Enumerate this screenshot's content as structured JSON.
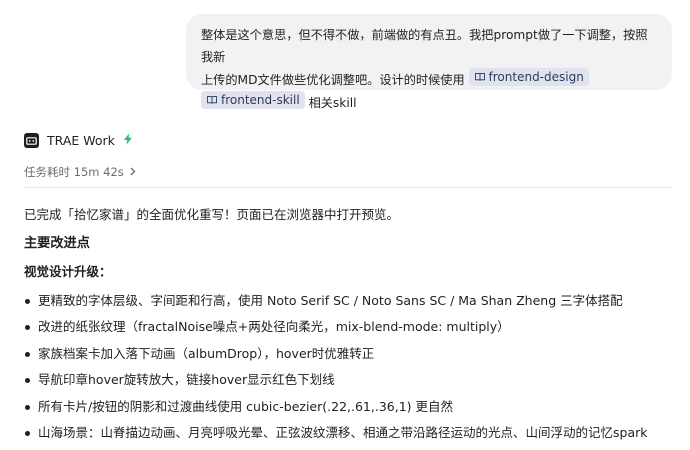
{
  "user_message": {
    "text_line1": "整体是这个意思，但不得不做，前端做的有点丑。我把prompt做了一下调整，按照我新",
    "text_line2a": "上传的MD文件做些优化调整吧。设计的时候使用",
    "skill_chip_1": "frontend-design",
    "skill_chip_2": "frontend-skill",
    "text_tail": "相关skill"
  },
  "agent": {
    "name": "TRAE Work",
    "task_time_label": "任务耗时 15m 42s"
  },
  "response": {
    "summary": "已完成「拾忆家谱」的全面优化重写！页面已在浏览器中打开预览。",
    "heading_main": "主要改进点",
    "heading_visual": "视觉设计升级：",
    "bullets": [
      "更精致的字体层级、字间距和行高，使用 Noto Serif SC / Noto Sans SC / Ma Shan Zheng 三字体搭配",
      "改进的纸张纹理（fractalNoise噪点+两处径向柔光，mix-blend-mode: multiply）",
      "家族档案卡加入落下动画（albumDrop），hover时优雅转正",
      "导航印章hover旋转放大，链接hover显示红色下划线",
      "所有卡片/按钮的阴影和过渡曲线使用 cubic-bezier(.22,.61,.36,1) 更自然",
      "山海场景：山脊描边动画、月亮呼吸光晕、正弦波纹漂移、相通之带沿路径运动的光点、山间浮动的记忆spark"
    ]
  },
  "colors": {
    "bubble_bg": "#f2f2f4",
    "chip_bg": "#dfe3f0",
    "accent_green": "#2bbf6f"
  },
  "icons": [
    "book-icon",
    "trae-logo-icon",
    "bolt-icon",
    "chevron-right-icon",
    "bullet-dot"
  ]
}
